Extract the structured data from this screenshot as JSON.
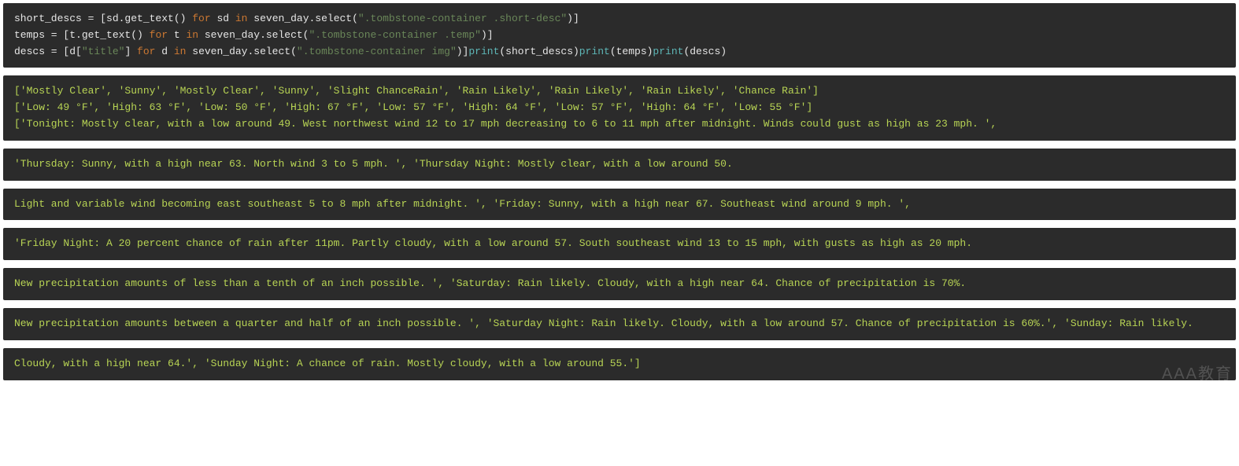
{
  "code": {
    "line1": {
      "a": "short_descs = [sd.get_text() ",
      "kw1": "for",
      "b": " sd ",
      "kw2": "in",
      "c": " seven_day.select(",
      "str": "\".tombstone-container .short-desc\"",
      "d": ")]"
    },
    "line2": {
      "a": "temps = [t.get_text() ",
      "kw1": "for",
      "b": " t ",
      "kw2": "in",
      "c": " seven_day.select(",
      "str": "\".tombstone-container .temp\"",
      "d": ")]"
    },
    "line3": {
      "a": "descs = [d[",
      "str1": "\"title\"",
      "b": "] ",
      "kw1": "for",
      "c": " d ",
      "kw2": "in",
      "d": " seven_day.select(",
      "str2": "\".tombstone-container img\"",
      "e": ")]",
      "fn1": "print",
      "f": "(short_descs)",
      "fn2": "print",
      "g": "(temps)",
      "fn3": "print",
      "h": "(descs)"
    }
  },
  "output": {
    "b1l1": "['Mostly Clear', 'Sunny', 'Mostly Clear', 'Sunny', 'Slight ChanceRain', 'Rain Likely', 'Rain Likely', 'Rain Likely', 'Chance Rain']",
    "b1l2": "['Low: 49 °F', 'High: 63 °F', 'Low: 50 °F', 'High: 67 °F', 'Low: 57 °F', 'High: 64 °F', 'Low: 57 °F', 'High: 64 °F', 'Low: 55 °F']",
    "b1l3": "['Tonight: Mostly clear, with a low around 49. West northwest wind 12 to 17 mph decreasing to 6 to 11 mph after midnight. Winds could gust as high as 23 mph. ',",
    "b2": "'Thursday: Sunny, with a high near 63. North wind 3 to 5 mph. ', 'Thursday Night: Mostly clear, with a low around 50.",
    "b3": "Light and variable wind becoming east southeast 5 to 8 mph after midnight. ', 'Friday: Sunny, with a high near 67. Southeast wind around 9 mph. ',",
    "b4": "'Friday Night: A 20 percent chance of rain after 11pm. Partly cloudy, with a low around 57. South southeast wind 13 to 15 mph, with gusts as high as 20 mph.",
    "b5": "New precipitation amounts of less than a tenth of an inch possible. ', 'Saturday: Rain likely. Cloudy, with a high near 64. Chance of precipitation is 70%.",
    "b6": "New precipitation amounts between a quarter and half of an inch possible. ', 'Saturday Night: Rain likely. Cloudy, with a low around 57. Chance of precipitation is 60%.', 'Sunday: Rain likely.",
    "b7": "Cloudy, with a high near 64.', 'Sunday Night: A chance of rain. Mostly cloudy, with a low around 55.']"
  },
  "watermark": "AAA教育"
}
